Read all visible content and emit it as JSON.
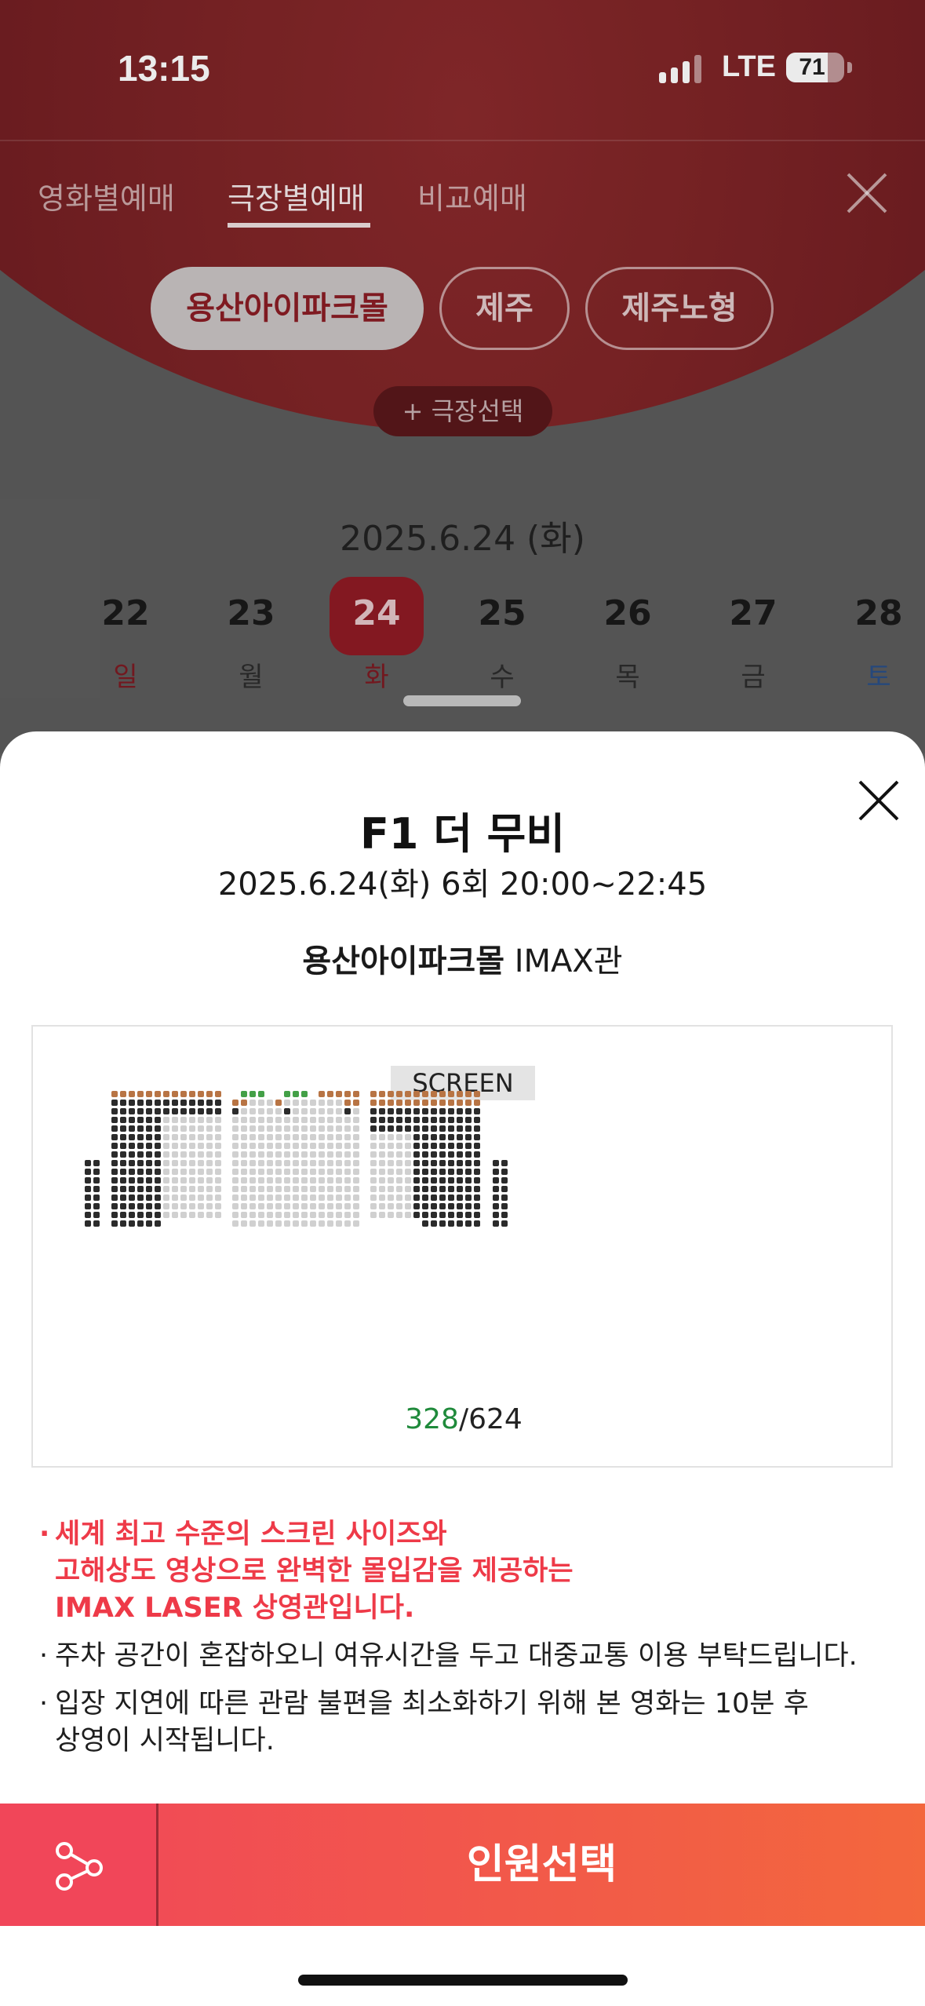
{
  "status_bar": {
    "time": "13:15",
    "network": "LTE",
    "battery": "71",
    "battery_level": 0.71
  },
  "tabs": [
    {
      "label": "영화별예매",
      "active": false
    },
    {
      "label": "극장별예매",
      "active": true
    },
    {
      "label": "비교예매",
      "active": false
    }
  ],
  "theater_chips": [
    {
      "label": "용산아이파크몰",
      "selected": true
    },
    {
      "label": "제주",
      "selected": false
    },
    {
      "label": "제주노형",
      "selected": false
    }
  ],
  "add_theater_label": "+ 극장선택",
  "date_title": "2025.6.24 (화)",
  "days": [
    {
      "num": "22",
      "dow": "일",
      "kind": "sun"
    },
    {
      "num": "23",
      "dow": "월",
      "kind": ""
    },
    {
      "num": "24",
      "dow": "화",
      "kind": "sel"
    },
    {
      "num": "25",
      "dow": "수",
      "kind": ""
    },
    {
      "num": "26",
      "dow": "목",
      "kind": ""
    },
    {
      "num": "27",
      "dow": "금",
      "kind": ""
    },
    {
      "num": "28",
      "dow": "토",
      "kind": "sat"
    }
  ],
  "sheet": {
    "title": "F1 더 무비",
    "showtime": "2025.6.24(화) 6회 20:00~22:45",
    "venue_name": "용산아이파크몰",
    "venue_hall": " IMAX관",
    "screen_label": "SCREEN",
    "seats_available": "328",
    "seats_total": "/624",
    "colors": {
      "available": "#d0d0d0",
      "sold": "#2b2b2b",
      "premium": "#b87444",
      "special": "#43a047"
    }
  },
  "notices": [
    {
      "style": "red",
      "lines": [
        "세계 최고 수준의 스크린 사이즈와",
        "고해상도 영상으로 완벽한 몰입감을 제공하는",
        "IMAX LASER 상영관입니다."
      ]
    },
    {
      "style": "normal",
      "lines": [
        "주차 공간이 혼잡하오니 여유시간을 두고 대중교통 이용 부탁드립니다."
      ]
    },
    {
      "style": "normal",
      "lines": [
        "입장 지연에 따른 관람 불편을 최소화하기 위해 본 영화는 10분 후",
        "상영이 시작됩니다."
      ]
    }
  ],
  "notice_bullet": "·",
  "bottom_bar": {
    "share_icon": "share-icon",
    "select_label": "인원선택"
  }
}
